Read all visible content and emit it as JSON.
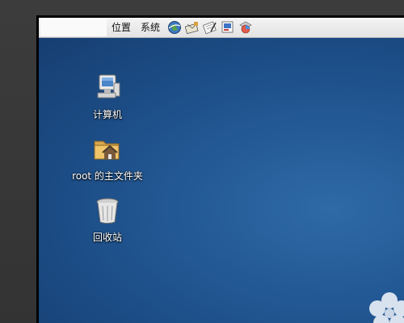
{
  "top_panel": {
    "menus": [
      {
        "label": "位置"
      },
      {
        "label": "系统"
      }
    ],
    "launchers": [
      {
        "icon": "web-browser-icon"
      },
      {
        "icon": "mail-client-icon"
      },
      {
        "icon": "text-editor-icon"
      },
      {
        "icon": "presentation-icon"
      },
      {
        "icon": "office-suite-icon"
      }
    ]
  },
  "desktop": {
    "icons": [
      {
        "label": "计算机",
        "icon": "computer-icon"
      },
      {
        "label": "root 的主文件夹",
        "icon": "home-folder-icon"
      },
      {
        "label": "回收站",
        "icon": "trash-icon"
      }
    ]
  },
  "colors": {
    "desktop_blue": "#1f5390",
    "panel_bg": "#eeeeee"
  }
}
